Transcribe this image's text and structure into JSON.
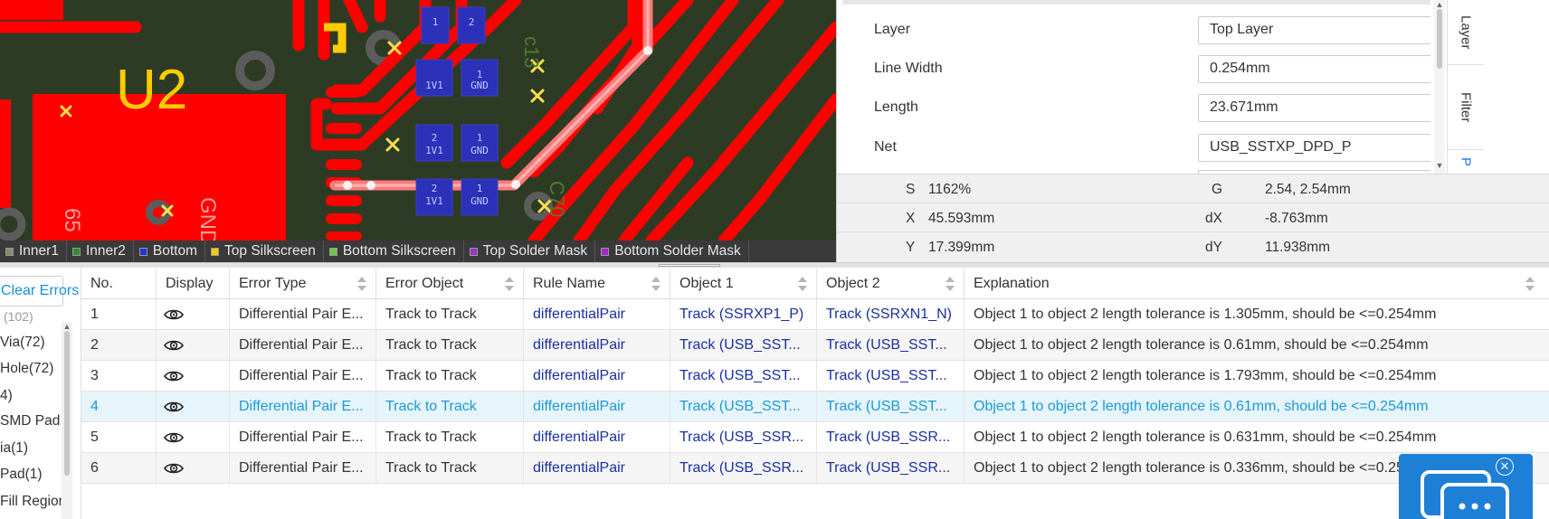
{
  "canvas": {
    "component_label": "U2",
    "text_65": "65",
    "text_gnd": "GND",
    "pads": [
      {
        "a": "1",
        "b": "2"
      },
      {
        "a": "1",
        "b": "1V1"
      },
      {
        "a": "1",
        "b": "GND"
      },
      {
        "a": "2",
        "b": "1V1"
      },
      {
        "a": "1",
        "b": "GND"
      },
      {
        "a": "2",
        "b": "1V1"
      },
      {
        "a": "1",
        "b": "GND"
      }
    ]
  },
  "layer_tabs": [
    {
      "label": "Inner1",
      "color": "#8a8a6a"
    },
    {
      "label": "Inner2",
      "color": "#2f8f2f"
    },
    {
      "label": "Bottom",
      "color": "#2233dd"
    },
    {
      "label": "Top Silkscreen",
      "color": "#ffcc00"
    },
    {
      "label": "Bottom Silkscreen",
      "color": "#66cc44"
    },
    {
      "label": "Top Solder Mask",
      "color": "#9933cc"
    },
    {
      "label": "Bottom Solder Mask",
      "color": "#aa22cc"
    }
  ],
  "properties": {
    "layer": {
      "label": "Layer",
      "value": "Top Layer"
    },
    "line_width": {
      "label": "Line Width",
      "value": "0.254mm"
    },
    "length": {
      "label": "Length",
      "value": "23.671mm"
    },
    "net": {
      "label": "Net",
      "value": "USB_SSTXP_DPD_P"
    }
  },
  "side_tabs": [
    {
      "label": "Layer"
    },
    {
      "label": "Filter"
    },
    {
      "label": "P"
    }
  ],
  "coords": {
    "s_label": "S",
    "s_value": "1162%",
    "g_label": "G",
    "g_value": "2.54, 2.54mm",
    "x_label": "X",
    "x_value": "45.593mm",
    "dx_label": "dX",
    "dx_value": "-8.763mm",
    "y_label": "Y",
    "y_value": "17.399mm",
    "dy_label": "dY",
    "dy_value": "11.938mm"
  },
  "left_panel": {
    "clear_button": "Clear Errors",
    "items": [
      "(102)",
      "Via(72)",
      "Hole(72)",
      "4)",
      "SMD Pad",
      "ia(1)",
      "Pad(1)",
      "Fill Region"
    ]
  },
  "table": {
    "columns": [
      "No.",
      "Display",
      "Error Type",
      "Error Object",
      "Rule Name",
      "Object 1",
      "Object 2",
      "Explanation"
    ],
    "rows": [
      {
        "no": "1",
        "error_type": "Differential Pair E...",
        "error_object": "Track to Track",
        "rule": "differentialPair",
        "obj1": "Track (SSRXP1_P)",
        "obj2": "Track (SSRXN1_N)",
        "explanation": "Object 1 to object 2 length tolerance is 1.305mm, should be <=0.254mm"
      },
      {
        "no": "2",
        "error_type": "Differential Pair E...",
        "error_object": "Track to Track",
        "rule": "differentialPair",
        "obj1": "Track (USB_SST...",
        "obj2": "Track (USB_SST...",
        "explanation": "Object 1 to object 2 length tolerance is 0.61mm, should be <=0.254mm"
      },
      {
        "no": "3",
        "error_type": "Differential Pair E...",
        "error_object": "Track to Track",
        "rule": "differentialPair",
        "obj1": "Track (USB_SST...",
        "obj2": "Track (USB_SST...",
        "explanation": "Object 1 to object 2 length tolerance is 1.793mm, should be <=0.254mm"
      },
      {
        "no": "4",
        "error_type": "Differential Pair E...",
        "error_object": "Track to Track",
        "rule": "differentialPair",
        "obj1": "Track (USB_SST...",
        "obj2": "Track (USB_SST...",
        "explanation": "Object 1 to object 2 length tolerance is 0.61mm, should be <=0.254mm"
      },
      {
        "no": "5",
        "error_type": "Differential Pair E...",
        "error_object": "Track to Track",
        "rule": "differentialPair",
        "obj1": "Track (USB_SSR...",
        "obj2": "Track (USB_SSR...",
        "explanation": "Object 1 to object 2 length tolerance is 0.631mm, should be <=0.254mm"
      },
      {
        "no": "6",
        "error_type": "Differential Pair E...",
        "error_object": "Track to Track",
        "rule": "differentialPair",
        "obj1": "Track (USB_SSR...",
        "obj2": "Track (USB_SSR...",
        "explanation": "Object 1 to object 2 length tolerance is 0.336mm, should be <=0.254mm"
      }
    ],
    "selected_row": 4
  }
}
